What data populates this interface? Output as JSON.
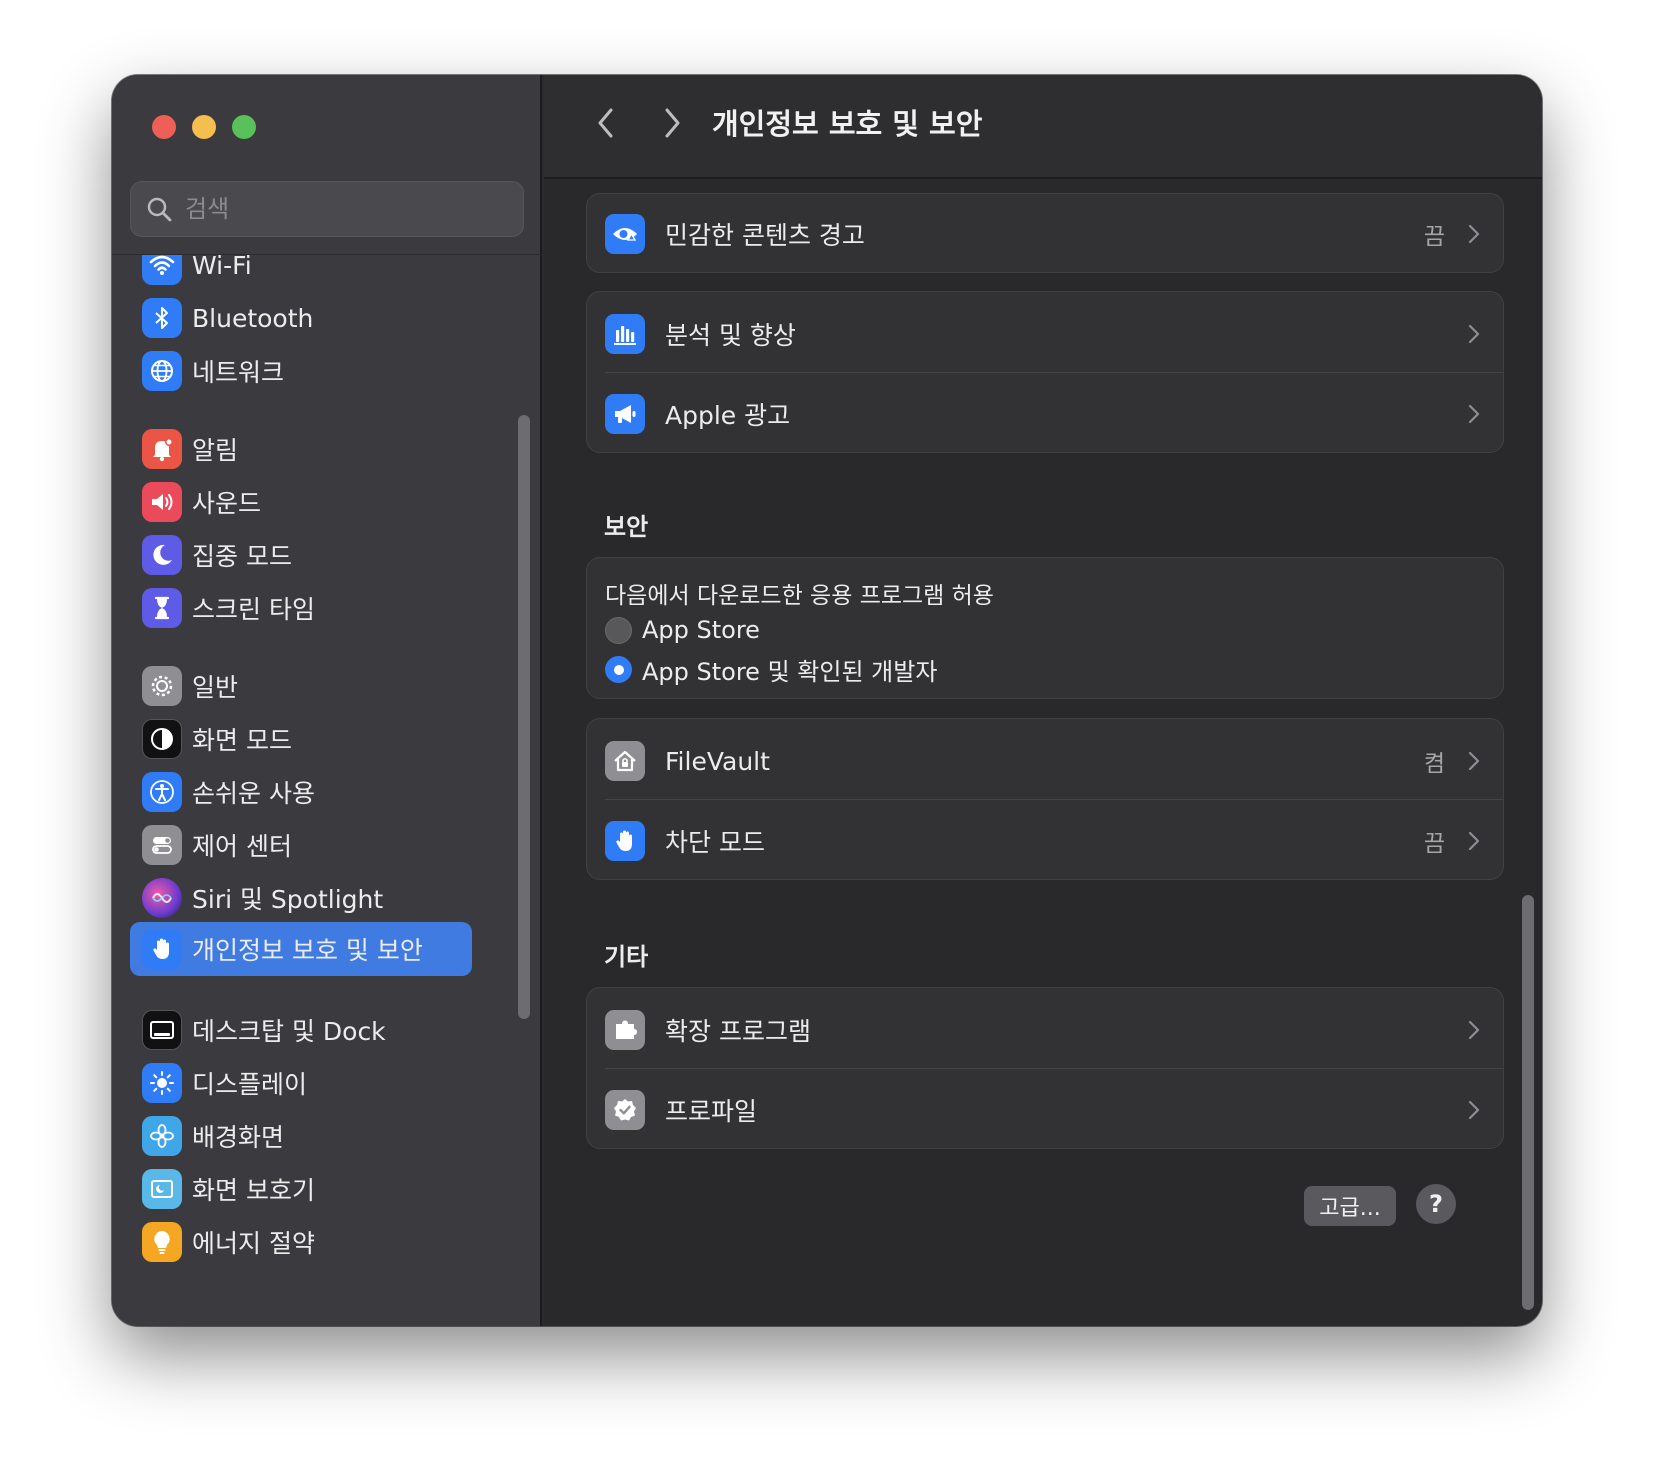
{
  "window": {
    "title": "개인정보 보호 및 보안"
  },
  "search": {
    "placeholder": "검색"
  },
  "sidebar": {
    "items": [
      {
        "label": "Wi-Fi",
        "icon": "wifi-icon",
        "color": "#2f7cf6"
      },
      {
        "label": "Bluetooth",
        "icon": "bluetooth-icon",
        "color": "#2f7cf6"
      },
      {
        "label": "네트워크",
        "icon": "globe-icon",
        "color": "#2f7cf6"
      },
      {
        "label": "알림",
        "icon": "bell-icon",
        "color": "#eb5545"
      },
      {
        "label": "사운드",
        "icon": "speaker-icon",
        "color": "#eb4a5b"
      },
      {
        "label": "집중 모드",
        "icon": "moon-icon",
        "color": "#5e5ce6"
      },
      {
        "label": "스크린 타임",
        "icon": "hourglass-icon",
        "color": "#5e5ce6"
      },
      {
        "label": "일반",
        "icon": "gear-icon",
        "color": "#8e8e93"
      },
      {
        "label": "화면 모드",
        "icon": "appearance-icon",
        "color": "#1c1c1e"
      },
      {
        "label": "손쉬운 사용",
        "icon": "accessibility-icon",
        "color": "#2f7cf6"
      },
      {
        "label": "제어 센터",
        "icon": "control-center-icon",
        "color": "#8e8e93"
      },
      {
        "label": "Siri 및 Spotlight",
        "icon": "siri-icon",
        "color": "#6a3bd0"
      },
      {
        "label": "개인정보 보호 및 보안",
        "icon": "hand-icon",
        "color": "#2f7cf6",
        "selected": true
      },
      {
        "label": "데스크탑 및 Dock",
        "icon": "dock-icon",
        "color": "#1c1c1e"
      },
      {
        "label": "디스플레이",
        "icon": "sun-icon",
        "color": "#2f7cf6"
      },
      {
        "label": "배경화면",
        "icon": "flower-icon",
        "color": "#3fa6e8"
      },
      {
        "label": "화면 보호기",
        "icon": "screensaver-icon",
        "color": "#5ab8e8"
      },
      {
        "label": "에너지 절약",
        "icon": "lightbulb-icon",
        "color": "#f5a623"
      }
    ]
  },
  "main": {
    "rows": {
      "sensitive": {
        "label": "민감한 콘텐츠 경고",
        "value": "끔",
        "icon": "eye-warning-icon"
      },
      "analytics": {
        "label": "분석 및 향상",
        "icon": "bar-chart-icon"
      },
      "apple_ads": {
        "label": "Apple 광고",
        "icon": "megaphone-icon"
      },
      "filevault": {
        "label": "FileVault",
        "value": "켬",
        "icon": "house-lock-icon"
      },
      "lockdown": {
        "label": "차단 모드",
        "value": "끔",
        "icon": "hand-icon"
      },
      "extensions": {
        "label": "확장 프로그램",
        "icon": "puzzle-icon"
      },
      "profiles": {
        "label": "프로파일",
        "icon": "checkmark-badge-icon"
      }
    },
    "sections": {
      "security": "보안",
      "others": "기타"
    },
    "gatekeeper": {
      "title": "다음에서 다운로드한 응용 프로그램 허용",
      "options": [
        "App Store",
        "App Store 및 확인된 개발자"
      ],
      "selected": "App Store 및 확인된 개발자"
    },
    "buttons": {
      "advanced": "고급...",
      "help": "?"
    }
  }
}
